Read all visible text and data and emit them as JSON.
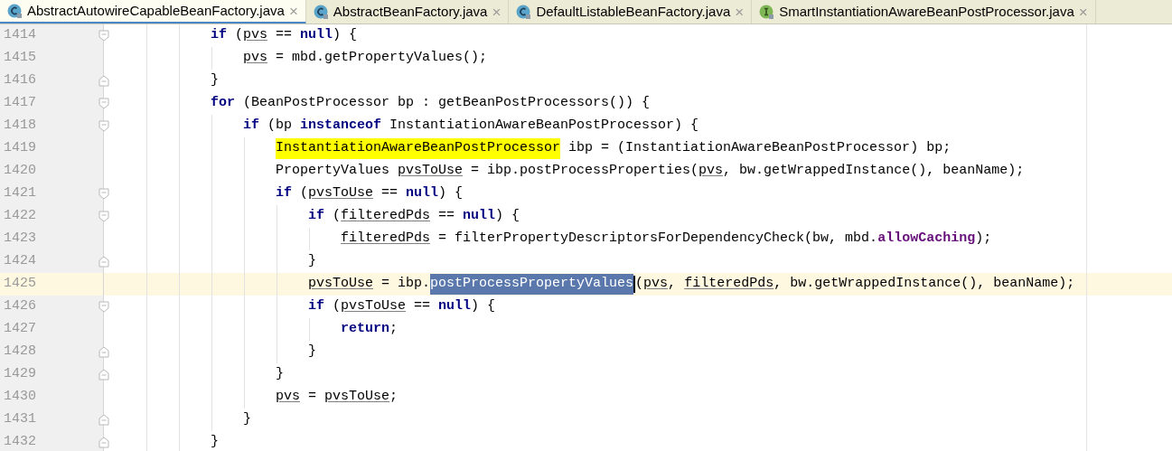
{
  "tabs": [
    {
      "label": "AbstractAutowireCapableBeanFactory.java",
      "kind": "class",
      "selected": true,
      "close": "×"
    },
    {
      "label": "AbstractBeanFactory.java",
      "kind": "class",
      "selected": false,
      "close": "×"
    },
    {
      "label": "DefaultListableBeanFactory.java",
      "kind": "class",
      "selected": false,
      "close": "×"
    },
    {
      "label": "SmartInstantiationAwareBeanPostProcessor.java",
      "kind": "interface",
      "selected": false,
      "close": "×"
    }
  ],
  "editor": {
    "lines": [
      {
        "number": "1414",
        "kind": "block-start",
        "current": false,
        "segments": [
          {
            "kind": "keyword",
            "text": "if"
          },
          {
            "kind": "text",
            "text": " ("
          },
          {
            "kind": "var",
            "text": "pvs"
          },
          {
            "kind": "text",
            "text": " == "
          },
          {
            "kind": "keyword",
            "text": "null"
          },
          {
            "kind": "text",
            "text": ") {"
          }
        ],
        "children": [
          {
            "number": "1415",
            "kind": "statement",
            "current": false,
            "segments": [
              {
                "kind": "var",
                "text": "pvs"
              },
              {
                "kind": "text",
                "text": " = mbd.getPropertyValues();"
              }
            ]
          }
        ]
      },
      {
        "number": "1416",
        "kind": "block-end",
        "current": false,
        "segments": [
          {
            "kind": "text",
            "text": "}"
          }
        ]
      },
      {
        "number": "1417",
        "kind": "block-start",
        "current": false,
        "segments": [
          {
            "kind": "keyword",
            "text": "for"
          },
          {
            "kind": "text",
            "text": " (BeanPostProcessor bp : getBeanPostProcessors()) {"
          }
        ],
        "children": [
          {
            "number": "1418",
            "kind": "block-start",
            "current": false,
            "segments": [
              {
                "kind": "keyword",
                "text": "if"
              },
              {
                "kind": "text",
                "text": " (bp "
              },
              {
                "kind": "keyword",
                "text": "instanceof"
              },
              {
                "kind": "text",
                "text": " InstantiationAwareBeanPostProcessor) {"
              }
            ],
            "children": [
              {
                "number": "1419",
                "kind": "statement",
                "current": false,
                "segments": [
                  {
                    "kind": "search-match",
                    "text": "InstantiationAwareBeanPostProcessor"
                  },
                  {
                    "kind": "text",
                    "text": " ibp = (InstantiationAwareBeanPostProcessor) bp;"
                  }
                ]
              },
              {
                "number": "1420",
                "kind": "statement",
                "current": false,
                "segments": [
                  {
                    "kind": "text",
                    "text": "PropertyValues "
                  },
                  {
                    "kind": "var",
                    "text": "pvsToUse"
                  },
                  {
                    "kind": "text",
                    "text": " = ibp.postProcessProperties("
                  },
                  {
                    "kind": "var",
                    "text": "pvs"
                  },
                  {
                    "kind": "text",
                    "text": ", bw.getWrappedInstance(), beanName);"
                  }
                ]
              },
              {
                "number": "1421",
                "kind": "block-start",
                "current": false,
                "segments": [
                  {
                    "kind": "keyword",
                    "text": "if"
                  },
                  {
                    "kind": "text",
                    "text": " ("
                  },
                  {
                    "kind": "var",
                    "text": "pvsToUse"
                  },
                  {
                    "kind": "text",
                    "text": " == "
                  },
                  {
                    "kind": "keyword",
                    "text": "null"
                  },
                  {
                    "kind": "text",
                    "text": ") {"
                  }
                ],
                "children": [
                  {
                    "number": "1422",
                    "kind": "block-start",
                    "current": false,
                    "segments": [
                      {
                        "kind": "keyword",
                        "text": "if"
                      },
                      {
                        "kind": "text",
                        "text": " ("
                      },
                      {
                        "kind": "var",
                        "text": "filteredPds"
                      },
                      {
                        "kind": "text",
                        "text": " == "
                      },
                      {
                        "kind": "keyword",
                        "text": "null"
                      },
                      {
                        "kind": "text",
                        "text": ") {"
                      }
                    ],
                    "children": [
                      {
                        "number": "1423",
                        "kind": "statement",
                        "current": false,
                        "segments": [
                          {
                            "kind": "var",
                            "text": "filteredPds"
                          },
                          {
                            "kind": "text",
                            "text": " = filterPropertyDescriptorsForDependencyCheck(bw, mbd."
                          },
                          {
                            "kind": "field",
                            "text": "allowCaching"
                          },
                          {
                            "kind": "text",
                            "text": ");"
                          }
                        ]
                      }
                    ]
                  },
                  {
                    "number": "1424",
                    "kind": "block-end",
                    "current": false,
                    "segments": [
                      {
                        "kind": "text",
                        "text": "}"
                      }
                    ]
                  },
                  {
                    "number": "1425",
                    "kind": "statement",
                    "current": true,
                    "segments": [
                      {
                        "kind": "var",
                        "text": "pvsToUse"
                      },
                      {
                        "kind": "text",
                        "text": " = ibp."
                      },
                      {
                        "kind": "selection",
                        "text": "postProcessPropertyValues"
                      },
                      {
                        "kind": "text",
                        "text": "("
                      },
                      {
                        "kind": "var",
                        "text": "pvs"
                      },
                      {
                        "kind": "text",
                        "text": ", "
                      },
                      {
                        "kind": "var",
                        "text": "filteredPds"
                      },
                      {
                        "kind": "text",
                        "text": ", bw.getWrappedInstance(), beanName);"
                      }
                    ]
                  },
                  {
                    "number": "1426",
                    "kind": "block-start",
                    "current": false,
                    "segments": [
                      {
                        "kind": "keyword",
                        "text": "if"
                      },
                      {
                        "kind": "text",
                        "text": " ("
                      },
                      {
                        "kind": "var",
                        "text": "pvsToUse"
                      },
                      {
                        "kind": "text",
                        "text": " == "
                      },
                      {
                        "kind": "keyword",
                        "text": "null"
                      },
                      {
                        "kind": "text",
                        "text": ") {"
                      }
                    ],
                    "children": [
                      {
                        "number": "1427",
                        "kind": "statement",
                        "current": false,
                        "segments": [
                          {
                            "kind": "keyword",
                            "text": "return"
                          },
                          {
                            "kind": "text",
                            "text": ";"
                          }
                        ]
                      }
                    ]
                  },
                  {
                    "number": "1428",
                    "kind": "block-end",
                    "current": false,
                    "segments": [
                      {
                        "kind": "text",
                        "text": "}"
                      }
                    ]
                  }
                ]
              },
              {
                "number": "1429",
                "kind": "block-end",
                "current": false,
                "segments": [
                  {
                    "kind": "text",
                    "text": "}"
                  }
                ]
              },
              {
                "number": "1430",
                "kind": "statement",
                "current": false,
                "segments": [
                  {
                    "kind": "var",
                    "text": "pvs"
                  },
                  {
                    "kind": "text",
                    "text": " = "
                  },
                  {
                    "kind": "var",
                    "text": "pvsToUse"
                  },
                  {
                    "kind": "text",
                    "text": ";"
                  }
                ]
              }
            ]
          },
          {
            "number": "1431",
            "kind": "block-end",
            "current": false,
            "segments": [
              {
                "kind": "text",
                "text": "}"
              }
            ]
          }
        ]
      },
      {
        "number": "1432",
        "kind": "block-end",
        "current": false,
        "segments": [
          {
            "kind": "text",
            "text": "}"
          }
        ]
      }
    ]
  }
}
